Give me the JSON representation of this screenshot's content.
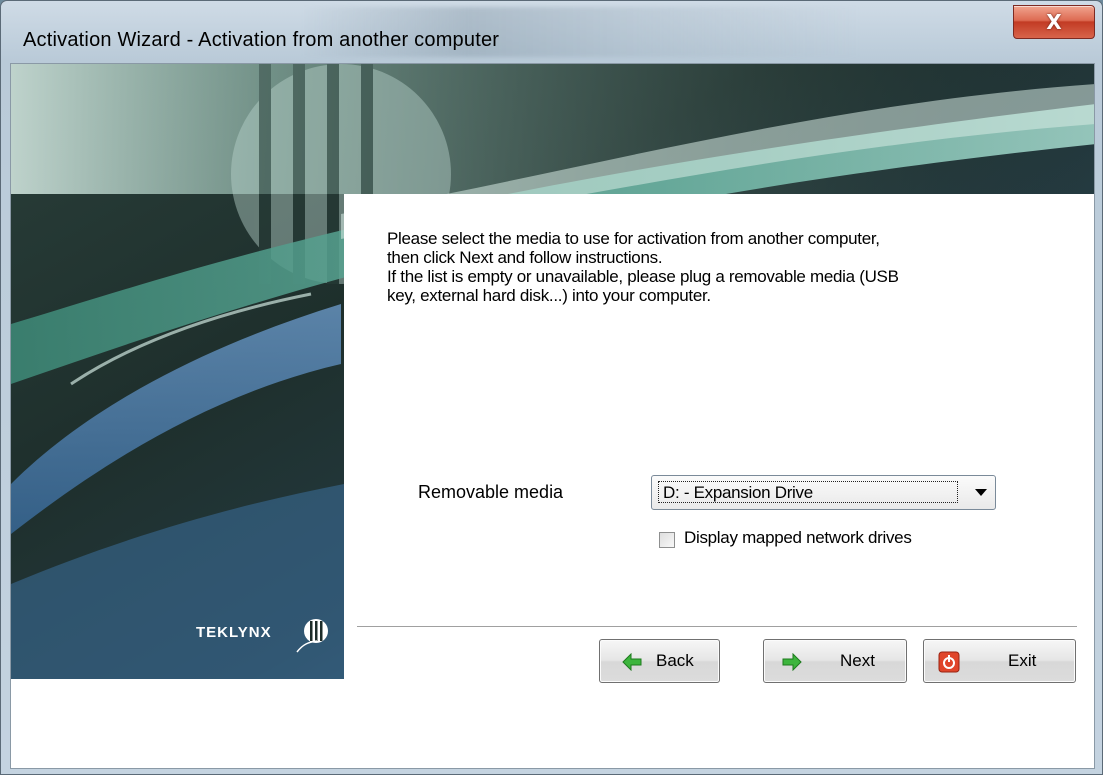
{
  "window": {
    "title": "Activation Wizard - Activation from another computer",
    "close_glyph": "X"
  },
  "banner": {
    "brand": "TEKLYNX",
    "colors": {
      "teal_dark": "#1f3b33",
      "teal_mid": "#3f7a6a",
      "teal_light": "#7cc0b0",
      "blue": "#5a86b4"
    }
  },
  "content": {
    "instructions": [
      "Please select the media to use for activation from another computer,",
      "then click Next and follow instructions.",
      "If the list is empty or unavailable, please plug a removable media (USB",
      "key, external hard disk...) into your computer."
    ],
    "media_label": "Removable media",
    "media_selected": "D: - Expansion Drive",
    "checkbox_label": "Display mapped network drives",
    "checkbox_checked": false
  },
  "buttons": {
    "back": "Back",
    "next": "Next",
    "exit": "Exit",
    "icons": {
      "back": "green-left-arrow-icon",
      "next": "green-right-arrow-icon",
      "exit": "red-power-icon"
    }
  }
}
